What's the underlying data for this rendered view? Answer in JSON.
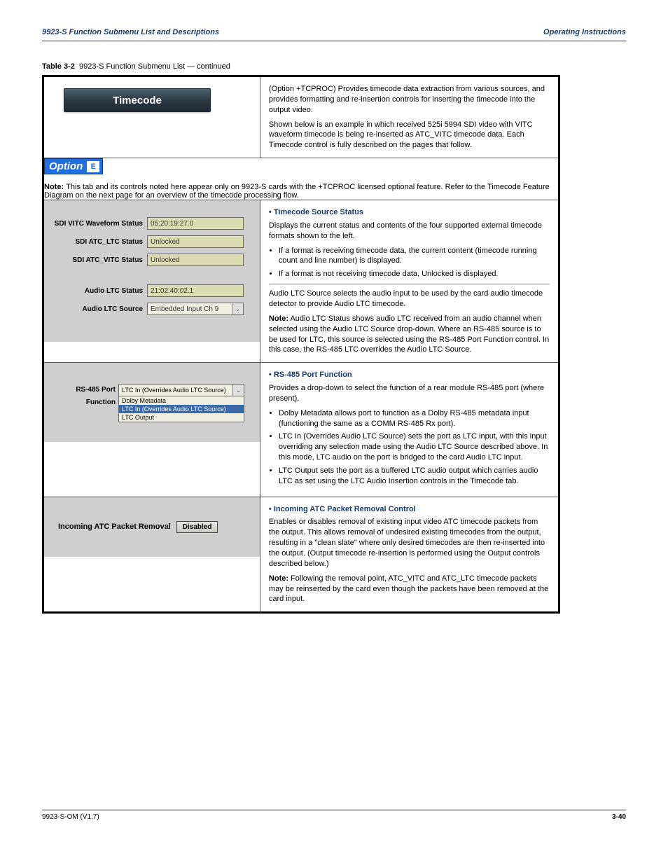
{
  "header": {
    "left": "9923-S Function Submenu List and Descriptions",
    "right": "Operating Instructions"
  },
  "table_caption": {
    "prefix": "Table 3-2",
    "suffix": "9923-S Function Submenu List — continued"
  },
  "rows": {
    "timecode": {
      "button": "Timecode",
      "desc_hdg": "(Option ",
      "desc_opt": "+TCPROC",
      "desc_rest": ") Provides timecode data extraction from various sources, and provides formatting and re-insertion controls for inserting the timecode into the output video.",
      "desc_line2": "Shown below is an example in which received 525i 5994 SDI video with VITC waveform timecode is being re-inserted as ATC_VITC timecode data. Each Timecode control is fully described on the pages that follow."
    },
    "option": {
      "chip": "Option",
      "note": "Note:",
      "note_text": " This tab and its controls noted here appear only on 9923-S cards with the +TCPROC licensed optional feature. Refer to the Timecode Feature Diagram on the next page for an overview of the timecode processing flow.",
      "extra": ""
    },
    "status": {
      "labels": {
        "sdi_vitc_wave": "SDI VITC Waveform Status",
        "sdi_atc_ltc": "SDI ATC_LTC Status",
        "sdi_atc_vitc": "SDI ATC_VITC Status",
        "audio_ltc_status": "Audio LTC Status",
        "audio_ltc_source": "Audio LTC Source"
      },
      "values": {
        "sdi_vitc_wave": "05:20:19:27.0",
        "sdi_atc_ltc": "Unlocked",
        "sdi_atc_vitc": "Unlocked",
        "audio_ltc_status": "21:02:40:02.1",
        "audio_ltc_source": "Embedded Input Ch 9"
      },
      "right_title": "• Timecode Source Status",
      "right_text1": "Displays the current status and contents of the four supported external timecode formats shown to the left.",
      "right_bullets": [
        "If a format is receiving timecode data, the current content (timecode running count and line number) is displayed.",
        "If a format is not receiving timecode data, Unlocked is displayed."
      ],
      "right_text2": "Audio LTC Source selects the audio input to be used by the card audio timecode detector to provide Audio LTC timecode.",
      "right_note_lbl": "Note:",
      "right_note_text": " Audio LTC Status shows audio LTC received from an audio channel when selected using the Audio LTC Source drop-down. Where an RS-485 source is to be used for LTC, this source is selected using the RS-485 Port Function control. In this case, the RS-485 LTC overrides the Audio LTC Source."
    },
    "rs485": {
      "label": "RS-485 Port Function",
      "selected": "LTC In (Overrides Audio LTC Source)",
      "options": [
        "Dolby Metadata",
        "LTC In (Overrides Audio LTC Source)",
        "LTC Output"
      ],
      "right_title": "• RS-485 Port Function",
      "right_text": "Provides a drop-down to select the function of a rear module RS-485 port (where present).",
      "right_bullets": [
        "Dolby Metadata allows port to function as a Dolby RS-485 metadata input (functioning the same as a COMM RS-485 Rx port).",
        "LTC In (Overrides Audio LTC Source) sets the port as LTC input, with this input overriding any selection made using the Audio LTC Source described above. In this mode, LTC audio on the port is bridged to the card Audio LTC input.",
        "LTC Output sets the port as a buffered LTC audio output which carries audio LTC as set using the LTC Audio Insertion controls in the Timecode tab."
      ]
    },
    "atc": {
      "label": "Incoming ATC Packet Removal",
      "btn": "Disabled",
      "right_title": "• Incoming ATC Packet Removal Control",
      "right_text": "Enables or disables removal of existing input video ATC timecode packets from the output. This allows removal of undesired existing timecodes from the output, resulting in a \"clean slate\" where only desired timecodes are then re-inserted into the output. (Output timecode re-insertion is performed using the Output controls described below.)",
      "right_note_lbl": "Note:",
      "right_note_text": " Following the removal point, ATC_VITC and ATC_LTC timecode packets may be reinserted by the card even though the packets have been removed at the card input."
    }
  },
  "footer": {
    "left": "9923-S-OM (V1.7)",
    "right": "3-40"
  }
}
